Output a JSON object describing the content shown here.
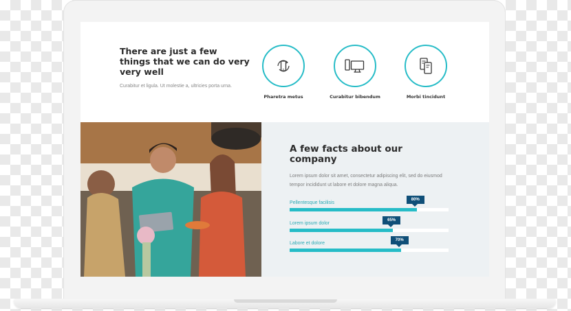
{
  "intro": {
    "headline": "There are just a few things that we can do very very well",
    "lead": "Curabitur et ligula. Ut molestie a, ultricies porta urna."
  },
  "features": [
    {
      "label": "Pharetra metus",
      "icon": "mobile-sync-icon"
    },
    {
      "label": "Curabitur bibendum",
      "icon": "devices-icon"
    },
    {
      "label": "Morbi tincidunt",
      "icon": "tablets-icon"
    }
  ],
  "facts": {
    "title": "A few facts about our company",
    "body": "Lorem ipsum dolor sit amet, consectetur adipiscing elit, sed do eiusmod tempor incididunt ut labore et dolore magna aliqua.",
    "bars": [
      {
        "label": "Pellentesque facilisis",
        "percent": 80,
        "badge": "80%"
      },
      {
        "label": "Lorem ipsum dolor",
        "percent": 65,
        "badge": "65%"
      },
      {
        "label": "Labore et dolore",
        "percent": 70,
        "badge": "70%"
      }
    ]
  },
  "colors": {
    "accent": "#26bcc7",
    "badge": "#0f4f78",
    "panel": "#edf1f3"
  }
}
